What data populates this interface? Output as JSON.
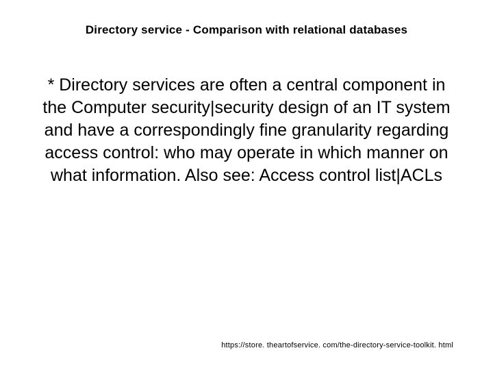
{
  "title": "Directory service -  Comparison with relational databases",
  "body": "* Directory services are often a central component in the Computer security|security design of an IT system and have a correspondingly fine granularity regarding access control: who may operate in which manner on what information. Also see: Access control list|ACLs",
  "footer": "https://store. theartofservice. com/the-directory-service-toolkit. html"
}
